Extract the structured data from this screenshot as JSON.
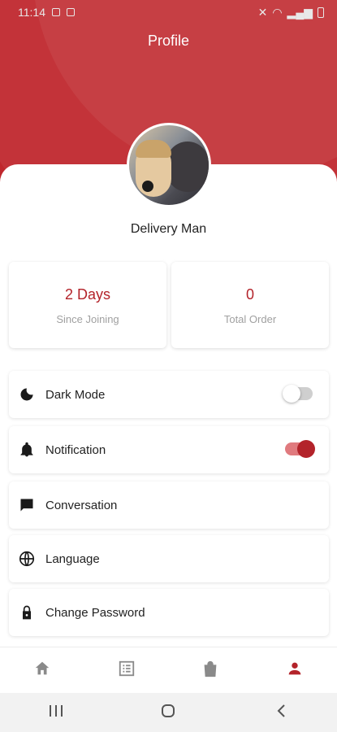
{
  "status_bar": {
    "time": "11:14",
    "icons": [
      "message-icon",
      "notification-icon",
      "battery-icon"
    ],
    "right_icons": [
      "mute-icon",
      "wifi-icon",
      "signal-icon",
      "battery-icon"
    ]
  },
  "header": {
    "title": "Profile",
    "color": "#c0272d"
  },
  "profile": {
    "name": "Delivery Man"
  },
  "stats": [
    {
      "value": "2 Days",
      "label": "Since Joining"
    },
    {
      "value": "0",
      "label": "Total Order"
    }
  ],
  "settings": [
    {
      "label": "Dark Mode",
      "icon": "moon-icon",
      "toggle": false
    },
    {
      "label": "Notification",
      "icon": "bell-icon",
      "toggle": true
    },
    {
      "label": "Conversation",
      "icon": "chat-icon"
    },
    {
      "label": "Language",
      "icon": "globe-icon"
    },
    {
      "label": "Change Password",
      "icon": "lock-icon"
    }
  ],
  "bottom_nav": [
    {
      "icon": "home-icon",
      "active": false
    },
    {
      "icon": "orders-list-icon",
      "active": false
    },
    {
      "icon": "shopping-bag-icon",
      "active": false
    },
    {
      "icon": "profile-icon",
      "active": true
    }
  ],
  "colors": {
    "accent": "#b3232a",
    "inactive": "#8a8a8a"
  }
}
